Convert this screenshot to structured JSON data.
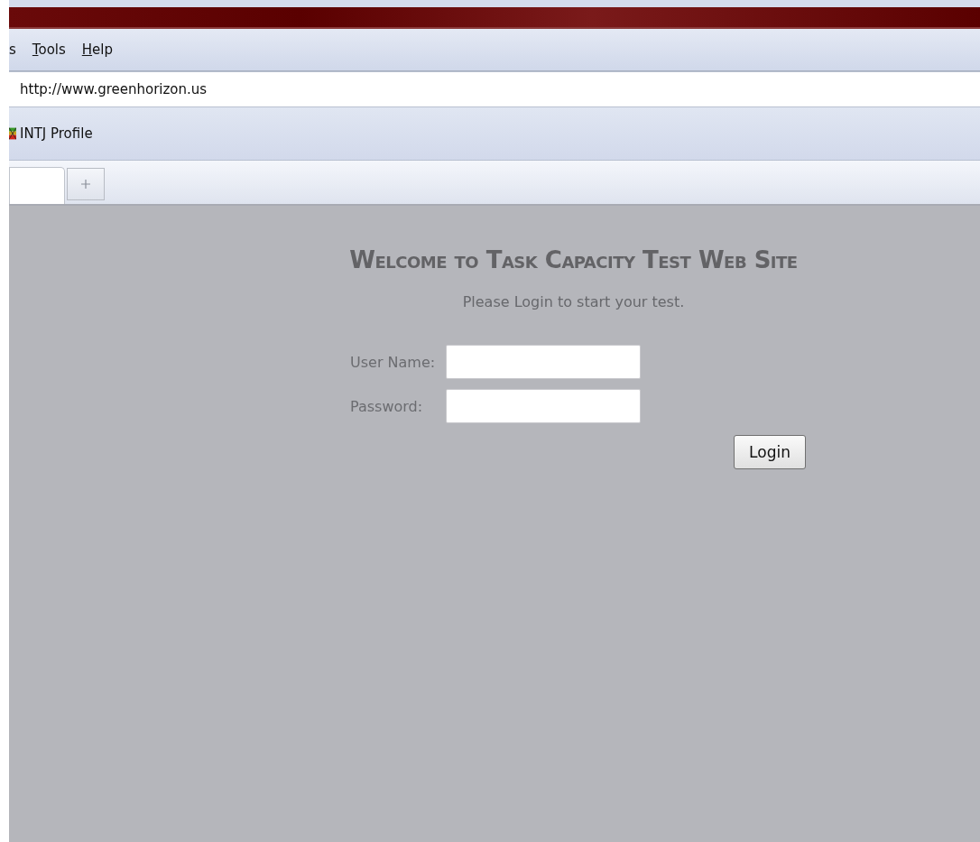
{
  "menu_bar": {
    "items": [
      {
        "label": "s"
      },
      {
        "label": "Tools"
      },
      {
        "label": "Help"
      }
    ]
  },
  "address_bar": {
    "value": "http://www.greenhorizon.us"
  },
  "bookmarks": [
    {
      "label": "INTJ Profile"
    }
  ],
  "tabs": [
    {
      "kind": "page",
      "selected": true
    },
    {
      "kind": "new"
    }
  ],
  "page": {
    "heading": "Welcome to Task Capacity Test Web Site",
    "subtitle": "Please Login to start your test.",
    "fields": [
      {
        "label": "User Name:"
      },
      {
        "label": "Password:"
      }
    ],
    "button": "Login"
  }
}
